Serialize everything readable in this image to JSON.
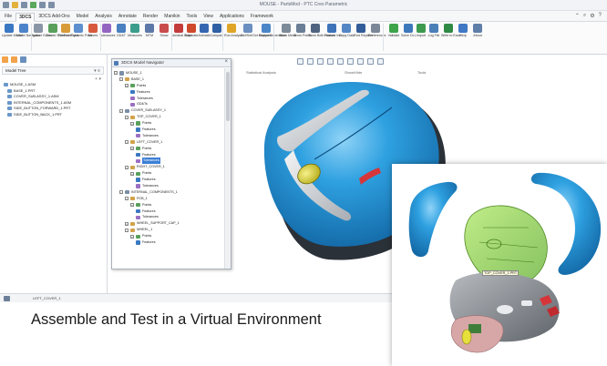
{
  "window": {
    "title": "MOUSE - PartsMod - PTC Creo Parametric"
  },
  "menu": {
    "tabs": [
      "File",
      "3DCS",
      "3DCS Add-Ons",
      "Model",
      "Analysis",
      "Annotate",
      "Render",
      "Manikin",
      "Tools",
      "View",
      "Applications",
      "Framework"
    ],
    "active": "3DCS"
  },
  "ribbon": {
    "buttons": [
      {
        "label": "Update Model",
        "icon": "update-icon",
        "color": "#3b78c4"
      },
      {
        "label": "Model Navigator",
        "icon": "navigator-icon",
        "color": "#4d84c9"
      },
      {
        "label": "Feature Editor",
        "icon": "feature-editor-icon",
        "color": "#8a96a6"
      },
      {
        "label": "Create/ Edit Point",
        "icon": "point-icon",
        "color": "#5aa05c"
      },
      {
        "label": "Feature Point",
        "icon": "feature-point-icon",
        "color": "#d89b39"
      },
      {
        "label": "Dynamic Point",
        "icon": "dynamic-point-icon",
        "color": "#5e8fce"
      },
      {
        "label": "Moves",
        "icon": "moves-icon",
        "color": "#d85a3e"
      },
      {
        "label": "Tolerances",
        "icon": "tolerance-icon",
        "color": "#9466c2"
      },
      {
        "label": "GD&T",
        "icon": "gdt-icon",
        "color": "#4a7fc0"
      },
      {
        "label": "Measures",
        "icon": "measure-icon",
        "color": "#3c9d8c"
      },
      {
        "label": "MTM",
        "icon": "mtm-icon",
        "color": "#5c78a8"
      },
      {
        "label": "Show",
        "icon": "show-icon",
        "color": "#c94b4b"
      },
      {
        "label": "Nominal Build",
        "icon": "build-icon",
        "color": "#c33b3b"
      },
      {
        "label": "Separate",
        "icon": "separate-icon",
        "color": "#cf4a2d"
      },
      {
        "label": "Animate",
        "icon": "animate-icon",
        "color": "#3567b0"
      },
      {
        "label": "Compare",
        "icon": "compare-icon",
        "color": "#2f60a5"
      },
      {
        "label": "Run Analysis",
        "icon": "run-icon",
        "color": "#e0a528"
      },
      {
        "label": "Get/Set/Get Analyses",
        "icon": "analyses-icon",
        "color": "#6b8fc0"
      },
      {
        "label": "Report Generation",
        "icon": "report-icon",
        "color": "#4b86c6"
      },
      {
        "label": "Show Mesh",
        "icon": "mesh-icon",
        "color": "#7d8b99"
      },
      {
        "label": "Show Points",
        "icon": "show-points-icon",
        "color": "#6a7e96"
      },
      {
        "label": "Show Both Names",
        "icon": "names-icon",
        "color": "#4f6480"
      },
      {
        "label": "Feature Info",
        "icon": "info-icon",
        "color": "#3e74b8"
      },
      {
        "label": "Copy Data",
        "icon": "copy-icon",
        "color": "#5386c4"
      },
      {
        "label": "Find Replace",
        "icon": "find-icon",
        "color": "#335d99"
      },
      {
        "label": "Preferences",
        "icon": "preferences-icon",
        "color": "#7b8796"
      },
      {
        "label": "Validate",
        "icon": "validate-icon",
        "color": "#3da44a"
      },
      {
        "label": "Solve DLL",
        "icon": "dll-icon",
        "color": "#3d78bb"
      },
      {
        "label": "Import",
        "icon": "import-icon",
        "color": "#3d9a4e"
      },
      {
        "label": "Log File",
        "icon": "log-icon",
        "color": "#4a7fb8"
      },
      {
        "label": "Write to Excel",
        "icon": "excel-icon",
        "color": "#2f8a45"
      },
      {
        "label": "Help",
        "icon": "help-icon",
        "color": "#3f78c4"
      },
      {
        "label": "About",
        "icon": "about-icon",
        "color": "#5f7ea8"
      }
    ],
    "groups": [
      "Model Update",
      "Feature Creation",
      "Model Creation",
      "Graphical Analysis",
      "Statistical Analysis",
      "Show/Hide",
      "Tools"
    ]
  },
  "modeltree": {
    "header": "Model Tree",
    "items": [
      {
        "label": "MOUSE_1.ASM",
        "level": 0
      },
      {
        "label": "BASE_1.PRT",
        "level": 1
      },
      {
        "label": "COVER_SUB-ASSY_1.ASM",
        "level": 1
      },
      {
        "label": "INTERNAL_COMPONENTS_1.ASM",
        "level": 1
      },
      {
        "label": "SIDE_BUTTON_FORWARD_1.PRT",
        "level": 1
      },
      {
        "label": "SIDE_BUTTON_BACK_1.PRT",
        "level": 1
      }
    ]
  },
  "navigator": {
    "title": "3DCS Model Navigator",
    "close": "×",
    "items": [
      {
        "label": "MOUSE_1",
        "level": 0,
        "pm": "−",
        "icon": "asm"
      },
      {
        "label": "BASE_1",
        "level": 1,
        "pm": "−",
        "icon": "part"
      },
      {
        "label": "Points",
        "level": 2,
        "pm": "+",
        "icon": "pts"
      },
      {
        "label": "Features",
        "level": 2,
        "pm": "",
        "icon": "feat"
      },
      {
        "label": "Tolerances",
        "level": 2,
        "pm": "",
        "icon": "tol"
      },
      {
        "label": "GD&Ts",
        "level": 2,
        "pm": "",
        "icon": "tol"
      },
      {
        "label": "COVER_SUB-ASSY_1",
        "level": 1,
        "pm": "−",
        "icon": "asm"
      },
      {
        "label": "TOP_COVER_1",
        "level": 2,
        "pm": "−",
        "icon": "part"
      },
      {
        "label": "Points",
        "level": 3,
        "pm": "+",
        "icon": "pts"
      },
      {
        "label": "Features",
        "level": 3,
        "pm": "",
        "icon": "feat"
      },
      {
        "label": "Tolerances",
        "level": 3,
        "pm": "",
        "icon": "tol"
      },
      {
        "label": "LEFT_COVER_1",
        "level": 2,
        "pm": "−",
        "icon": "part"
      },
      {
        "label": "Points",
        "level": 3,
        "pm": "+",
        "icon": "pts"
      },
      {
        "label": "Features",
        "level": 3,
        "pm": "",
        "icon": "feat"
      },
      {
        "label": "Tolerances",
        "level": 3,
        "pm": "",
        "icon": "tol",
        "selected": true
      },
      {
        "label": "RIGHT_COVER_1",
        "level": 2,
        "pm": "−",
        "icon": "part"
      },
      {
        "label": "Points",
        "level": 3,
        "pm": "+",
        "icon": "pts"
      },
      {
        "label": "Features",
        "level": 3,
        "pm": "",
        "icon": "feat"
      },
      {
        "label": "Tolerances",
        "level": 3,
        "pm": "",
        "icon": "tol"
      },
      {
        "label": "INTERNAL_COMPONENTS_1",
        "level": 1,
        "pm": "−",
        "icon": "asm"
      },
      {
        "label": "PCB_1",
        "level": 2,
        "pm": "−",
        "icon": "part"
      },
      {
        "label": "Points",
        "level": 3,
        "pm": "+",
        "icon": "pts"
      },
      {
        "label": "Features",
        "level": 3,
        "pm": "",
        "icon": "feat"
      },
      {
        "label": "Tolerances",
        "level": 3,
        "pm": "",
        "icon": "tol"
      },
      {
        "label": "WHEEL_SUPPORT_CAP_1",
        "level": 2,
        "pm": "+",
        "icon": "part"
      },
      {
        "label": "WHEEL_1",
        "level": 2,
        "pm": "−",
        "icon": "part"
      },
      {
        "label": "Points",
        "level": 3,
        "pm": "+",
        "icon": "pts"
      },
      {
        "label": "Features",
        "level": 3,
        "pm": "",
        "icon": "feat"
      }
    ]
  },
  "status": {
    "text": "LEFT_COVER_1"
  },
  "caption": "Assemble and Test in a Virtual Environment",
  "callout": {
    "label": "TOP_COVER_1.PRT"
  },
  "colors": {
    "shell_blue": "#1e8fd6",
    "shell_highlight": "#6fc4f2",
    "stripe_silver": "#c9cdd2",
    "wheel_yellow": "#e6df3c",
    "base_grey": "#7e8389",
    "green_transparent": "#8fd24a",
    "side_red": "#d6353a"
  }
}
